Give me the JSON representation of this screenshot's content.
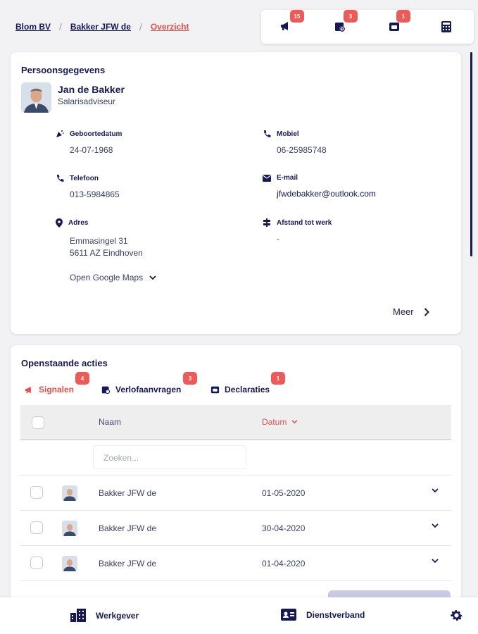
{
  "breadcrumb": {
    "items": [
      "Blom BV",
      "Bakker JFW de"
    ],
    "current": "Overzicht"
  },
  "topbar": {
    "signals_badge": "15",
    "leave_badge": "3",
    "claims_badge": "1",
    "icons": [
      "megaphone-icon",
      "calendar-clock-icon",
      "wallet-icon",
      "calculator-icon"
    ]
  },
  "profile": {
    "section_title": "Persoonsgegevens",
    "name": "Jan de Bakker",
    "role": "Salarisadviseur",
    "birthdate_label": "Geboortedatum",
    "birthdate": "24-07-1968",
    "mobile_label": "Mobiel",
    "mobile": "06-25985748",
    "phone_label": "Telefoon",
    "phone": "013-5984865",
    "email_label": "E-mail",
    "email": "jfwdebakker@outlook.com",
    "address_label": "Adres",
    "address_line1": "Emmasingel 31",
    "address_line2": "5611 AZ Eindhoven",
    "distance_label": "Afstand tot werk",
    "distance": "-",
    "maps_label": "Open Google Maps",
    "more_label": "Meer"
  },
  "actions": {
    "section_title": "Openstaande acties",
    "tabs": [
      {
        "label": "Signalen",
        "badge": "4"
      },
      {
        "label": "Verlofaanvragen",
        "badge": "3"
      },
      {
        "label": "Declaraties",
        "badge": "1"
      }
    ],
    "columns": {
      "name": "Naam",
      "date": "Datum"
    },
    "search_placeholder": "Zoeken...",
    "rows": [
      {
        "name": "Bakker JFW de",
        "date": "01-05-2020"
      },
      {
        "name": "Bakker JFW de",
        "date": "30-04-2020"
      },
      {
        "name": "Bakker JFW de",
        "date": "01-04-2020"
      }
    ]
  },
  "bottom_nav": {
    "employer": "Werkgever",
    "employment": "Dienstverband"
  },
  "colors": {
    "navy": "#15195a",
    "accent": "#e8504a",
    "badge": "#ee5a57"
  }
}
